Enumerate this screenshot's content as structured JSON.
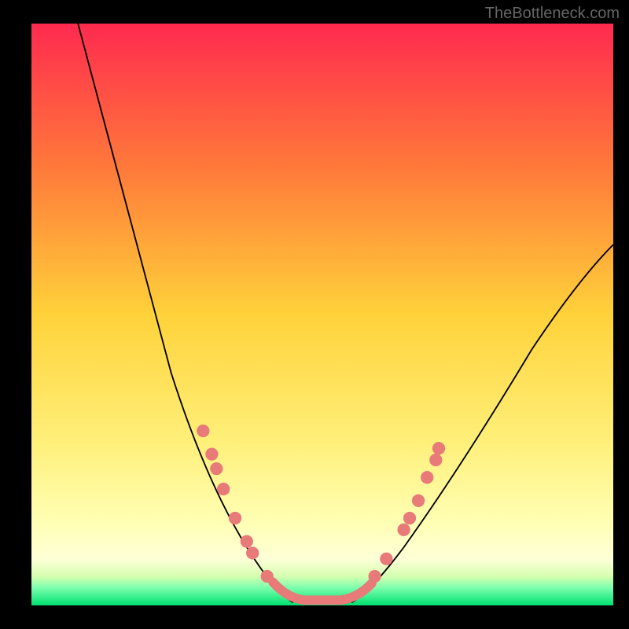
{
  "watermark": "TheBottleneck.com",
  "chart_data": {
    "type": "line",
    "title": "",
    "xlabel": "",
    "ylabel": "",
    "xlim": [
      0,
      100
    ],
    "ylim": [
      0,
      100
    ],
    "gradient_colors": {
      "top": "#ff2a4f",
      "upper_mid": "#ff7a3a",
      "mid": "#ffd23a",
      "lower_mid": "#fff07a",
      "lower": "#ffffb5",
      "bottom_band": "#2bff84",
      "very_bottom": "#00e070"
    },
    "curve_left": [
      {
        "x": 8,
        "y": 100
      },
      {
        "x": 12,
        "y": 80
      },
      {
        "x": 18,
        "y": 55
      },
      {
        "x": 24,
        "y": 35
      },
      {
        "x": 30,
        "y": 20
      },
      {
        "x": 36,
        "y": 8
      },
      {
        "x": 42,
        "y": 2
      },
      {
        "x": 45,
        "y": 0
      }
    ],
    "curve_right": [
      {
        "x": 55,
        "y": 0
      },
      {
        "x": 58,
        "y": 2
      },
      {
        "x": 64,
        "y": 10
      },
      {
        "x": 72,
        "y": 22
      },
      {
        "x": 80,
        "y": 35
      },
      {
        "x": 88,
        "y": 48
      },
      {
        "x": 96,
        "y": 58
      },
      {
        "x": 100,
        "y": 62
      }
    ],
    "markers_left": [
      {
        "x": 29.5,
        "y": 30
      },
      {
        "x": 31,
        "y": 26
      },
      {
        "x": 31.8,
        "y": 23.5
      },
      {
        "x": 33,
        "y": 20
      },
      {
        "x": 35,
        "y": 15
      },
      {
        "x": 37,
        "y": 11
      },
      {
        "x": 38,
        "y": 9
      },
      {
        "x": 40.5,
        "y": 5
      }
    ],
    "markers_right": [
      {
        "x": 59,
        "y": 5
      },
      {
        "x": 61,
        "y": 8
      },
      {
        "x": 64,
        "y": 13
      },
      {
        "x": 65,
        "y": 15
      },
      {
        "x": 66.5,
        "y": 18
      },
      {
        "x": 68,
        "y": 22
      },
      {
        "x": 69.5,
        "y": 25
      },
      {
        "x": 70,
        "y": 27
      }
    ],
    "bottom_segment": [
      {
        "x": 44,
        "y": 1
      },
      {
        "x": 46,
        "y": 0.5
      },
      {
        "x": 50,
        "y": 0.3
      },
      {
        "x": 54,
        "y": 0.5
      },
      {
        "x": 56,
        "y": 1
      }
    ],
    "marker_color": "#e87a7a",
    "curve_color": "#000000"
  }
}
